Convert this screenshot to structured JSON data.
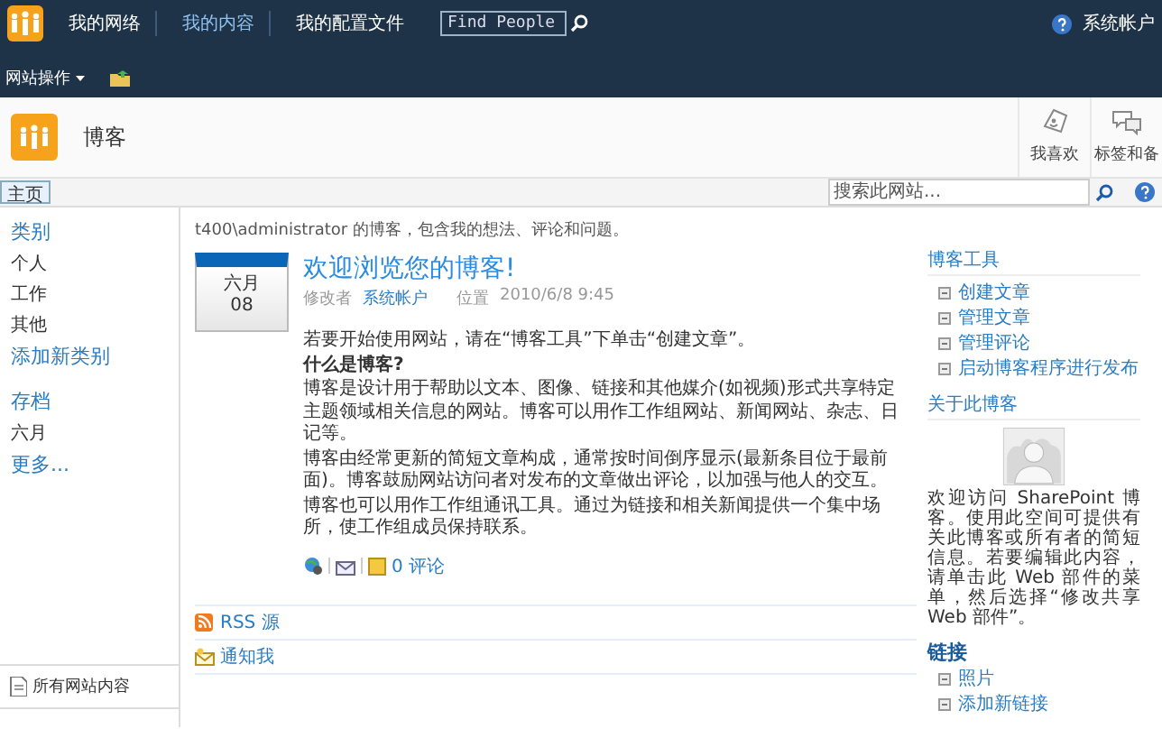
{
  "top_bar": {
    "nav": [
      {
        "label": "我的网络",
        "selected": false
      },
      {
        "label": "我的内容",
        "selected": true
      },
      {
        "label": "我的配置文件",
        "selected": false
      }
    ],
    "search": {
      "placeholder": "Find People"
    },
    "user": "系统帐户",
    "site_actions": "网站操作"
  },
  "title_area": {
    "title": "博客",
    "buttons": [
      "我喜欢",
      "标签和备"
    ]
  },
  "nav_bar": {
    "tabs": [
      {
        "label": "主页",
        "selected": true
      }
    ],
    "search": {
      "placeholder": "搜索此网站..."
    }
  },
  "sidebar": {
    "categories": {
      "heading": "类别",
      "items": [
        "个人",
        "工作",
        "其他"
      ],
      "add": "添加新类别"
    },
    "archive": {
      "heading": "存档",
      "items": [
        "六月"
      ],
      "more": "更多..."
    },
    "all_content": "所有网站内容"
  },
  "main": {
    "description": "t400\\administrator 的博客，包含我的想法、评论和问题。",
    "post": {
      "month": "六月",
      "day": "08",
      "title": "欢迎浏览您的博客!",
      "by_label": "修改者",
      "author": "系统帐户",
      "at_label": "位置",
      "date": "2010/6/8 9:45",
      "paragraphs": [
        {
          "kind": "text",
          "text": "若要开始使用网站，请在“博客工具”下单击“创建文章”。"
        },
        {
          "kind": "heading",
          "text": "什么是博客?"
        },
        {
          "kind": "text",
          "text": "博客是设计用于帮助以文本、图像、链接和其他媒介(如视频)形式共享特定主题领域相关信息的网站。博客可以用作工作组网站、新闻网站、杂志、日记等。"
        },
        {
          "kind": "text",
          "text": "博客由经常更新的简短文章构成，通常按时间倒序显示(最新条目位于最前面)。博客鼓励网站访问者对发布的文章做出评论，以加强与他人的交互。"
        },
        {
          "kind": "text",
          "text": "博客也可以用作工作组通讯工具。通过为链接和相关新闻提供一个集中场所，使工作组成员保持联系。"
        }
      ],
      "comments": "0 评论"
    },
    "feeds": [
      "RSS 源",
      "通知我"
    ]
  },
  "right_panel": {
    "tools": {
      "heading": "博客工具",
      "items": [
        "创建文章",
        "管理文章",
        "管理评论",
        "启动博客程序进行发布"
      ]
    },
    "about": {
      "heading": "关于此博客",
      "text": "欢迎访问 SharePoint 博客。使用此空间可提供有关此博客或所有者的简短信息。若要编辑此内容，请单击此 Web 部件的菜单，然后选择“修改共享 Web 部件”。"
    },
    "links": {
      "heading": "链接",
      "items": [
        "照片"
      ],
      "add": "添加新链接"
    }
  }
}
